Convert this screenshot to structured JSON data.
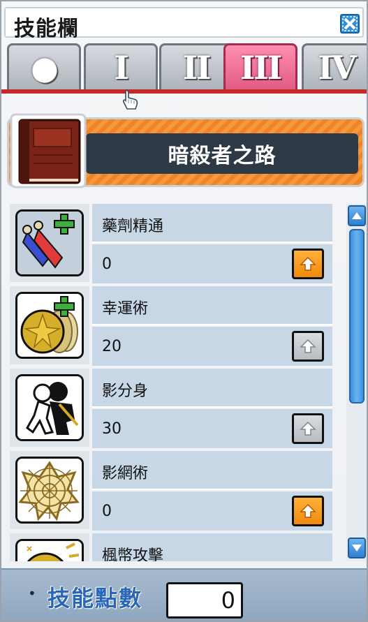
{
  "window": {
    "title": "技能欄"
  },
  "tabs": [
    {
      "label": "●",
      "active": false
    },
    {
      "label": "I",
      "active": false
    },
    {
      "label": "II",
      "active": false
    },
    {
      "label": "III",
      "active": true
    },
    {
      "label": "IV",
      "active": false
    }
  ],
  "job": {
    "name": "暗殺者之路",
    "icon": "red-book-icon"
  },
  "skills": [
    {
      "name": "藥劑精通",
      "level": "0",
      "icon": "potion-mastery-icon",
      "upgrade_enabled": true
    },
    {
      "name": "幸運術",
      "level": "20",
      "icon": "lucky-coin-icon",
      "upgrade_enabled": false
    },
    {
      "name": "影分身",
      "level": "30",
      "icon": "shadow-partner-icon",
      "upgrade_enabled": false
    },
    {
      "name": "影網術",
      "level": "0",
      "icon": "shadow-web-icon",
      "upgrade_enabled": true
    },
    {
      "name": "楓幣攻擊",
      "level": "",
      "icon": "meso-explosion-icon",
      "upgrade_enabled": true
    }
  ],
  "footer": {
    "bullet": "•",
    "skill_points_label": "技能點數",
    "skill_points_value": "0"
  },
  "colors": {
    "active_tab": "#e25b84",
    "banner_orange": "#f08a26",
    "skill_cell": "#c8d7e6",
    "footer": "#9bb0c6",
    "accent_red": "#c42a2a"
  }
}
